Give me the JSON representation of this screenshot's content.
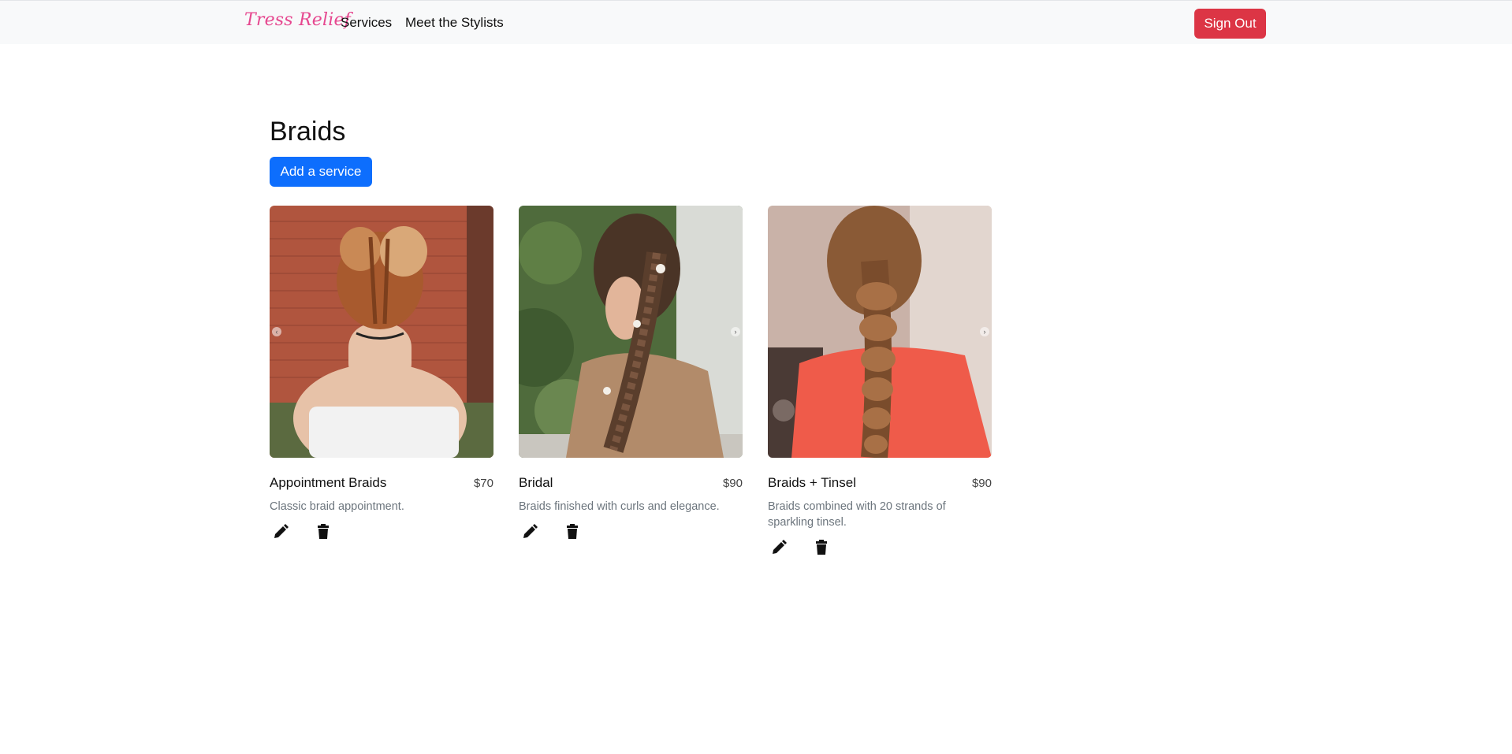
{
  "navbar": {
    "brand": "Tress Relief",
    "links": [
      {
        "label": "Services"
      },
      {
        "label": "Meet the Stylists"
      }
    ],
    "sign_out_label": "Sign Out",
    "colors": {
      "brand": "#e6478f",
      "background": "#f8f9fa",
      "sign_out": "#dc3545"
    }
  },
  "main": {
    "title": "Braids",
    "add_label": "Add a service",
    "add_color": "#0d6efd",
    "services": [
      {
        "name": "Appointment Braids",
        "price": "$70",
        "description": "Classic braid appointment.",
        "image": "photo-back-of-head-double-braided-buns-brick-wall"
      },
      {
        "name": "Bridal",
        "price": "$90",
        "description": "Braids finished with curls and elegance.",
        "image": "photo-side-braid-with-flower-pins-fur-coat"
      },
      {
        "name": "Braids + Tinsel",
        "price": "$90",
        "description": "Braids combined with 20 strands of sparkling tinsel.",
        "image": "photo-long-bubble-braid-red-top"
      }
    ],
    "icons": {
      "edit": "pencil-icon",
      "delete": "trash-icon",
      "prev": "chevron-left-icon",
      "next": "chevron-right-icon"
    }
  }
}
